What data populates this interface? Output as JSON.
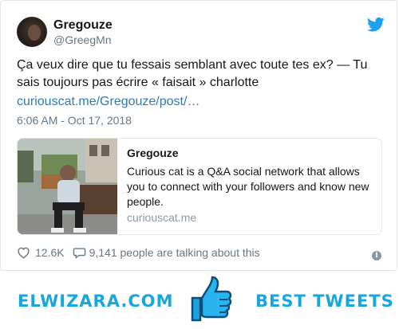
{
  "tweet": {
    "display_name": "Gregouze",
    "handle": "@GreegMn",
    "text": "Ça veux dire que tu fessais semblant avec toute tes ex? — Tu sais toujours pas écrire « faisait » charlotte",
    "link": "curiouscat.me/Gregouze/post/…",
    "timestamp": "6:06 AM - Oct 17, 2018",
    "likes": "12.6K",
    "talking": "9,141 people are talking about this",
    "info_glyph": "i",
    "brand_color": "#1da1f2",
    "link_color": "#2b7bb9"
  },
  "card": {
    "title": "Gregouze",
    "description": "Curious cat is a Q&A social network that allows you to connect with your followers and know new people.",
    "domain": "curiouscat.me"
  },
  "banner": {
    "left_text": "ELWIZARA.COM",
    "right_text": "BEST TWEETS",
    "accent": "#19a6dd"
  }
}
